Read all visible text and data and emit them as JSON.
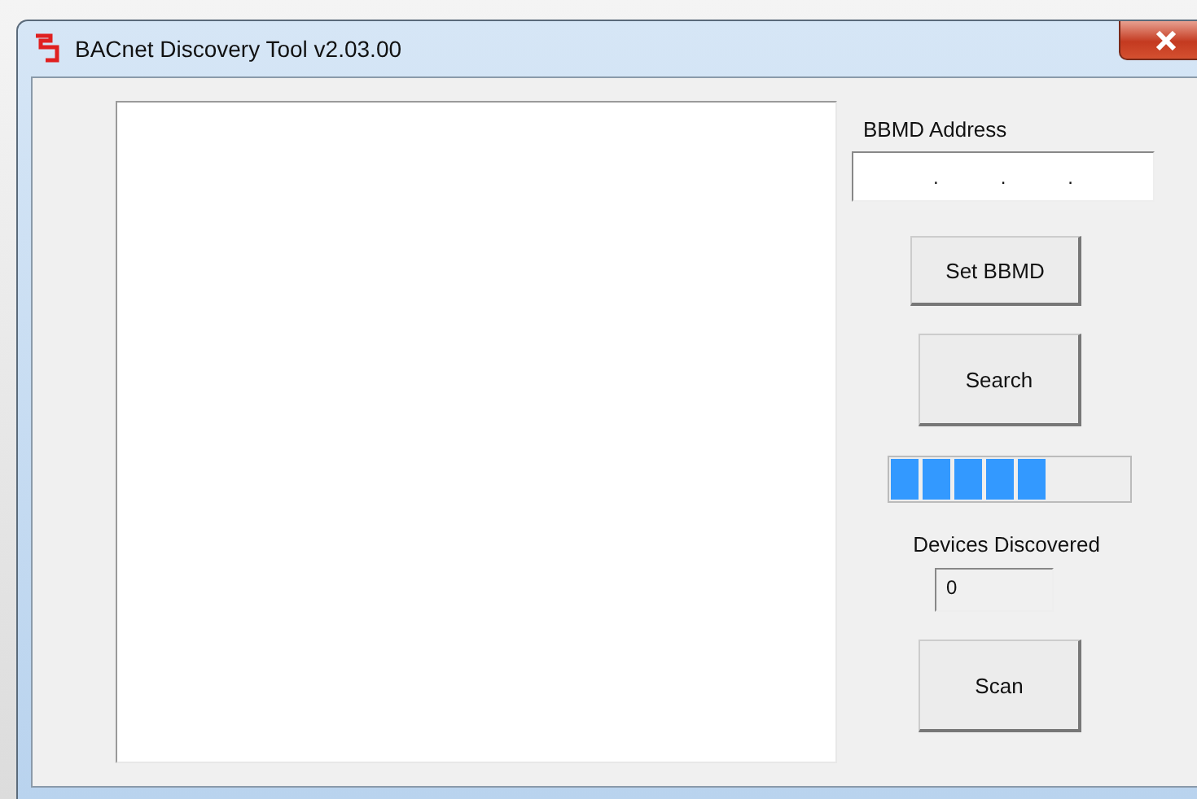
{
  "window": {
    "title": "BACnet Discovery Tool v2.03.00"
  },
  "bbmd": {
    "label": "BBMD Address",
    "separators": [
      ".",
      ".",
      "."
    ]
  },
  "buttons": {
    "set_bbmd": "Set BBMD",
    "search": "Search",
    "scan": "Scan"
  },
  "progress": {
    "level": 0.65
  },
  "devices": {
    "label": "Devices Discovered",
    "count": "0"
  }
}
